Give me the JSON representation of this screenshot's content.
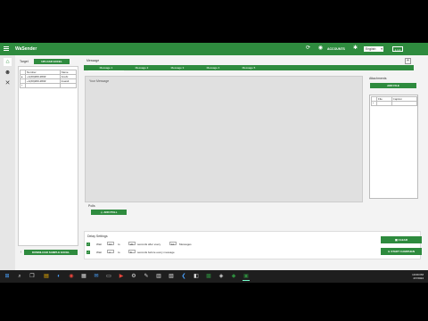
{
  "window": {
    "app_name": "WaSender",
    "account_label": "ACCOUNTS",
    "language": "English",
    "version": "1.1.0"
  },
  "target": {
    "label": "Target",
    "upload_button": "UPLOAD EXCEL",
    "columns": [
      "Number",
      "Name"
    ],
    "rows": [
      {
        "marker": "▸",
        "number": "+1(##)###-####",
        "name": "Anubi"
      },
      {
        "marker": "",
        "number": "+1(##)###-####",
        "name": "Inasidi"
      },
      {
        "marker": "*",
        "number": "",
        "name": ""
      }
    ],
    "download_button": "DOWNLOAD SAMPLE EXCEL"
  },
  "message": {
    "label": "Message",
    "tabs": [
      "Message 1",
      "Message 2",
      "Message 3",
      "Message 4",
      "Message 5"
    ],
    "placeholder": "Your Message"
  },
  "attachments": {
    "label": "Attachments",
    "add_button": "ADD FILE",
    "columns": [
      "File",
      "Caption"
    ],
    "rows": [
      {
        "marker": "*",
        "file": "",
        "caption": ""
      }
    ]
  },
  "polls": {
    "label": "Polls",
    "add_button": "ADD POLL"
  },
  "delay_settings": {
    "label": "Delay Settings",
    "row1": {
      "prefix": "Wait",
      "from": "10",
      "to_label": "to",
      "to": "20",
      "middle": "seconds after every",
      "count": "10",
      "suffix": "Messages"
    },
    "row2": {
      "prefix": "Wait",
      "from": "4",
      "to_label": "to",
      "to": "8",
      "suffix": "seconds before every message"
    },
    "clear_button": "CLEAR",
    "start_button": "START CAMPAIGN"
  },
  "taskbar": {
    "time": "10:09 PM",
    "date": "4/7/2024"
  },
  "colors": {
    "brand": "#2e8b3e",
    "background": "#f3f3f3",
    "message_area": "#e0e0e0"
  }
}
